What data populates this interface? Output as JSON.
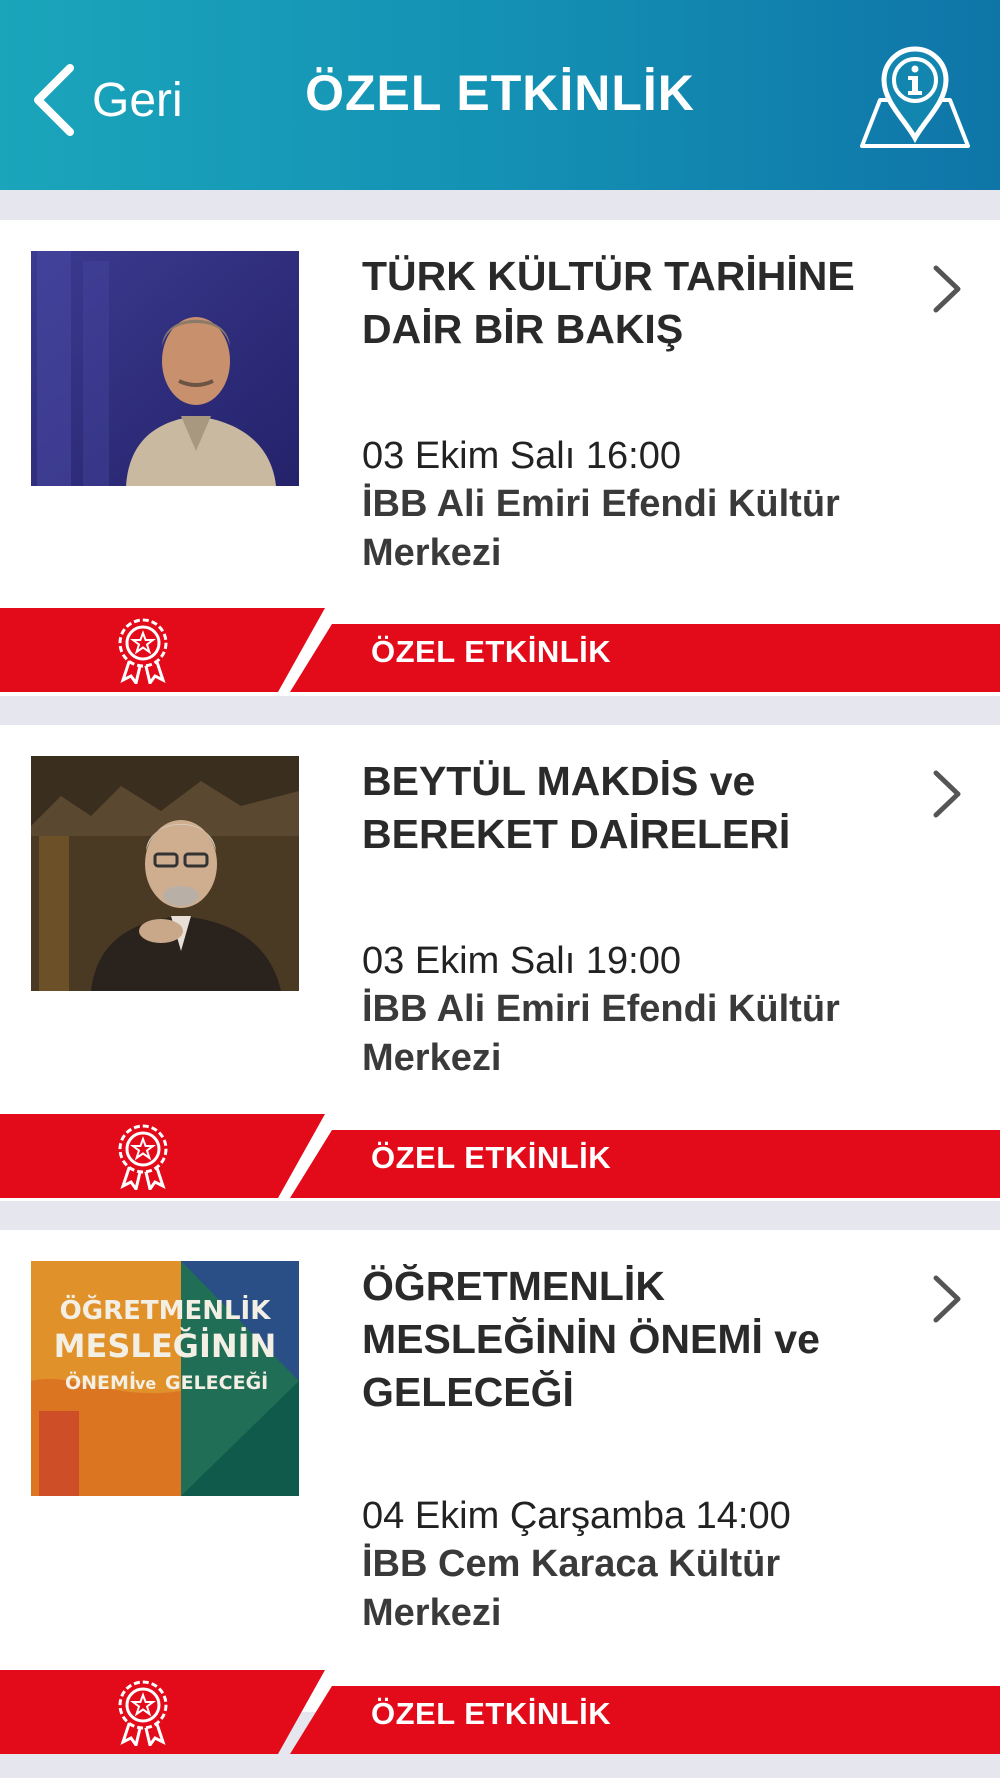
{
  "header": {
    "back_label": "Geri",
    "title": "ÖZEL ETKİNLİK",
    "info_icon": "map-pin-info-icon"
  },
  "colors": {
    "header_start": "#1aa5bb",
    "header_end": "#0f75a8",
    "banner_red": "#e30a1a",
    "separator": "#e6e6ee"
  },
  "events": [
    {
      "title": "TÜRK KÜLTÜR TARİHİNE DAİR BİR BAKIŞ",
      "date": "03 Ekim Salı 16:00",
      "venue": "İBB Ali Emiri Efendi Kültür Merkezi",
      "tag": "ÖZEL ETKİNLİK",
      "tag_icon": "award-rosette-icon"
    },
    {
      "title": "BEYTÜL MAKDİS ve BEREKET DAİRELERİ",
      "date": "03 Ekim Salı 19:00",
      "venue": "İBB Ali Emiri Efendi Kültür Merkezi",
      "tag": "ÖZEL ETKİNLİK",
      "tag_icon": "award-rosette-icon"
    },
    {
      "title": "ÖĞRETMENLİK MESLEĞİNİN ÖNEMİ ve GELECEĞİ",
      "date": "04 Ekim Çarşamba 14:00",
      "venue": "İBB Cem Karaca Kültür Merkezi",
      "tag": "ÖZEL ETKİNLİK",
      "tag_icon": "award-rosette-icon",
      "poster_text": {
        "line1": "ÖĞRETMENLİK",
        "line2": "MESLEĞİNİN",
        "line3a": "ÖNEMİ",
        "line3b": "ve",
        "line3c": "GELECEĞİ"
      }
    }
  ]
}
